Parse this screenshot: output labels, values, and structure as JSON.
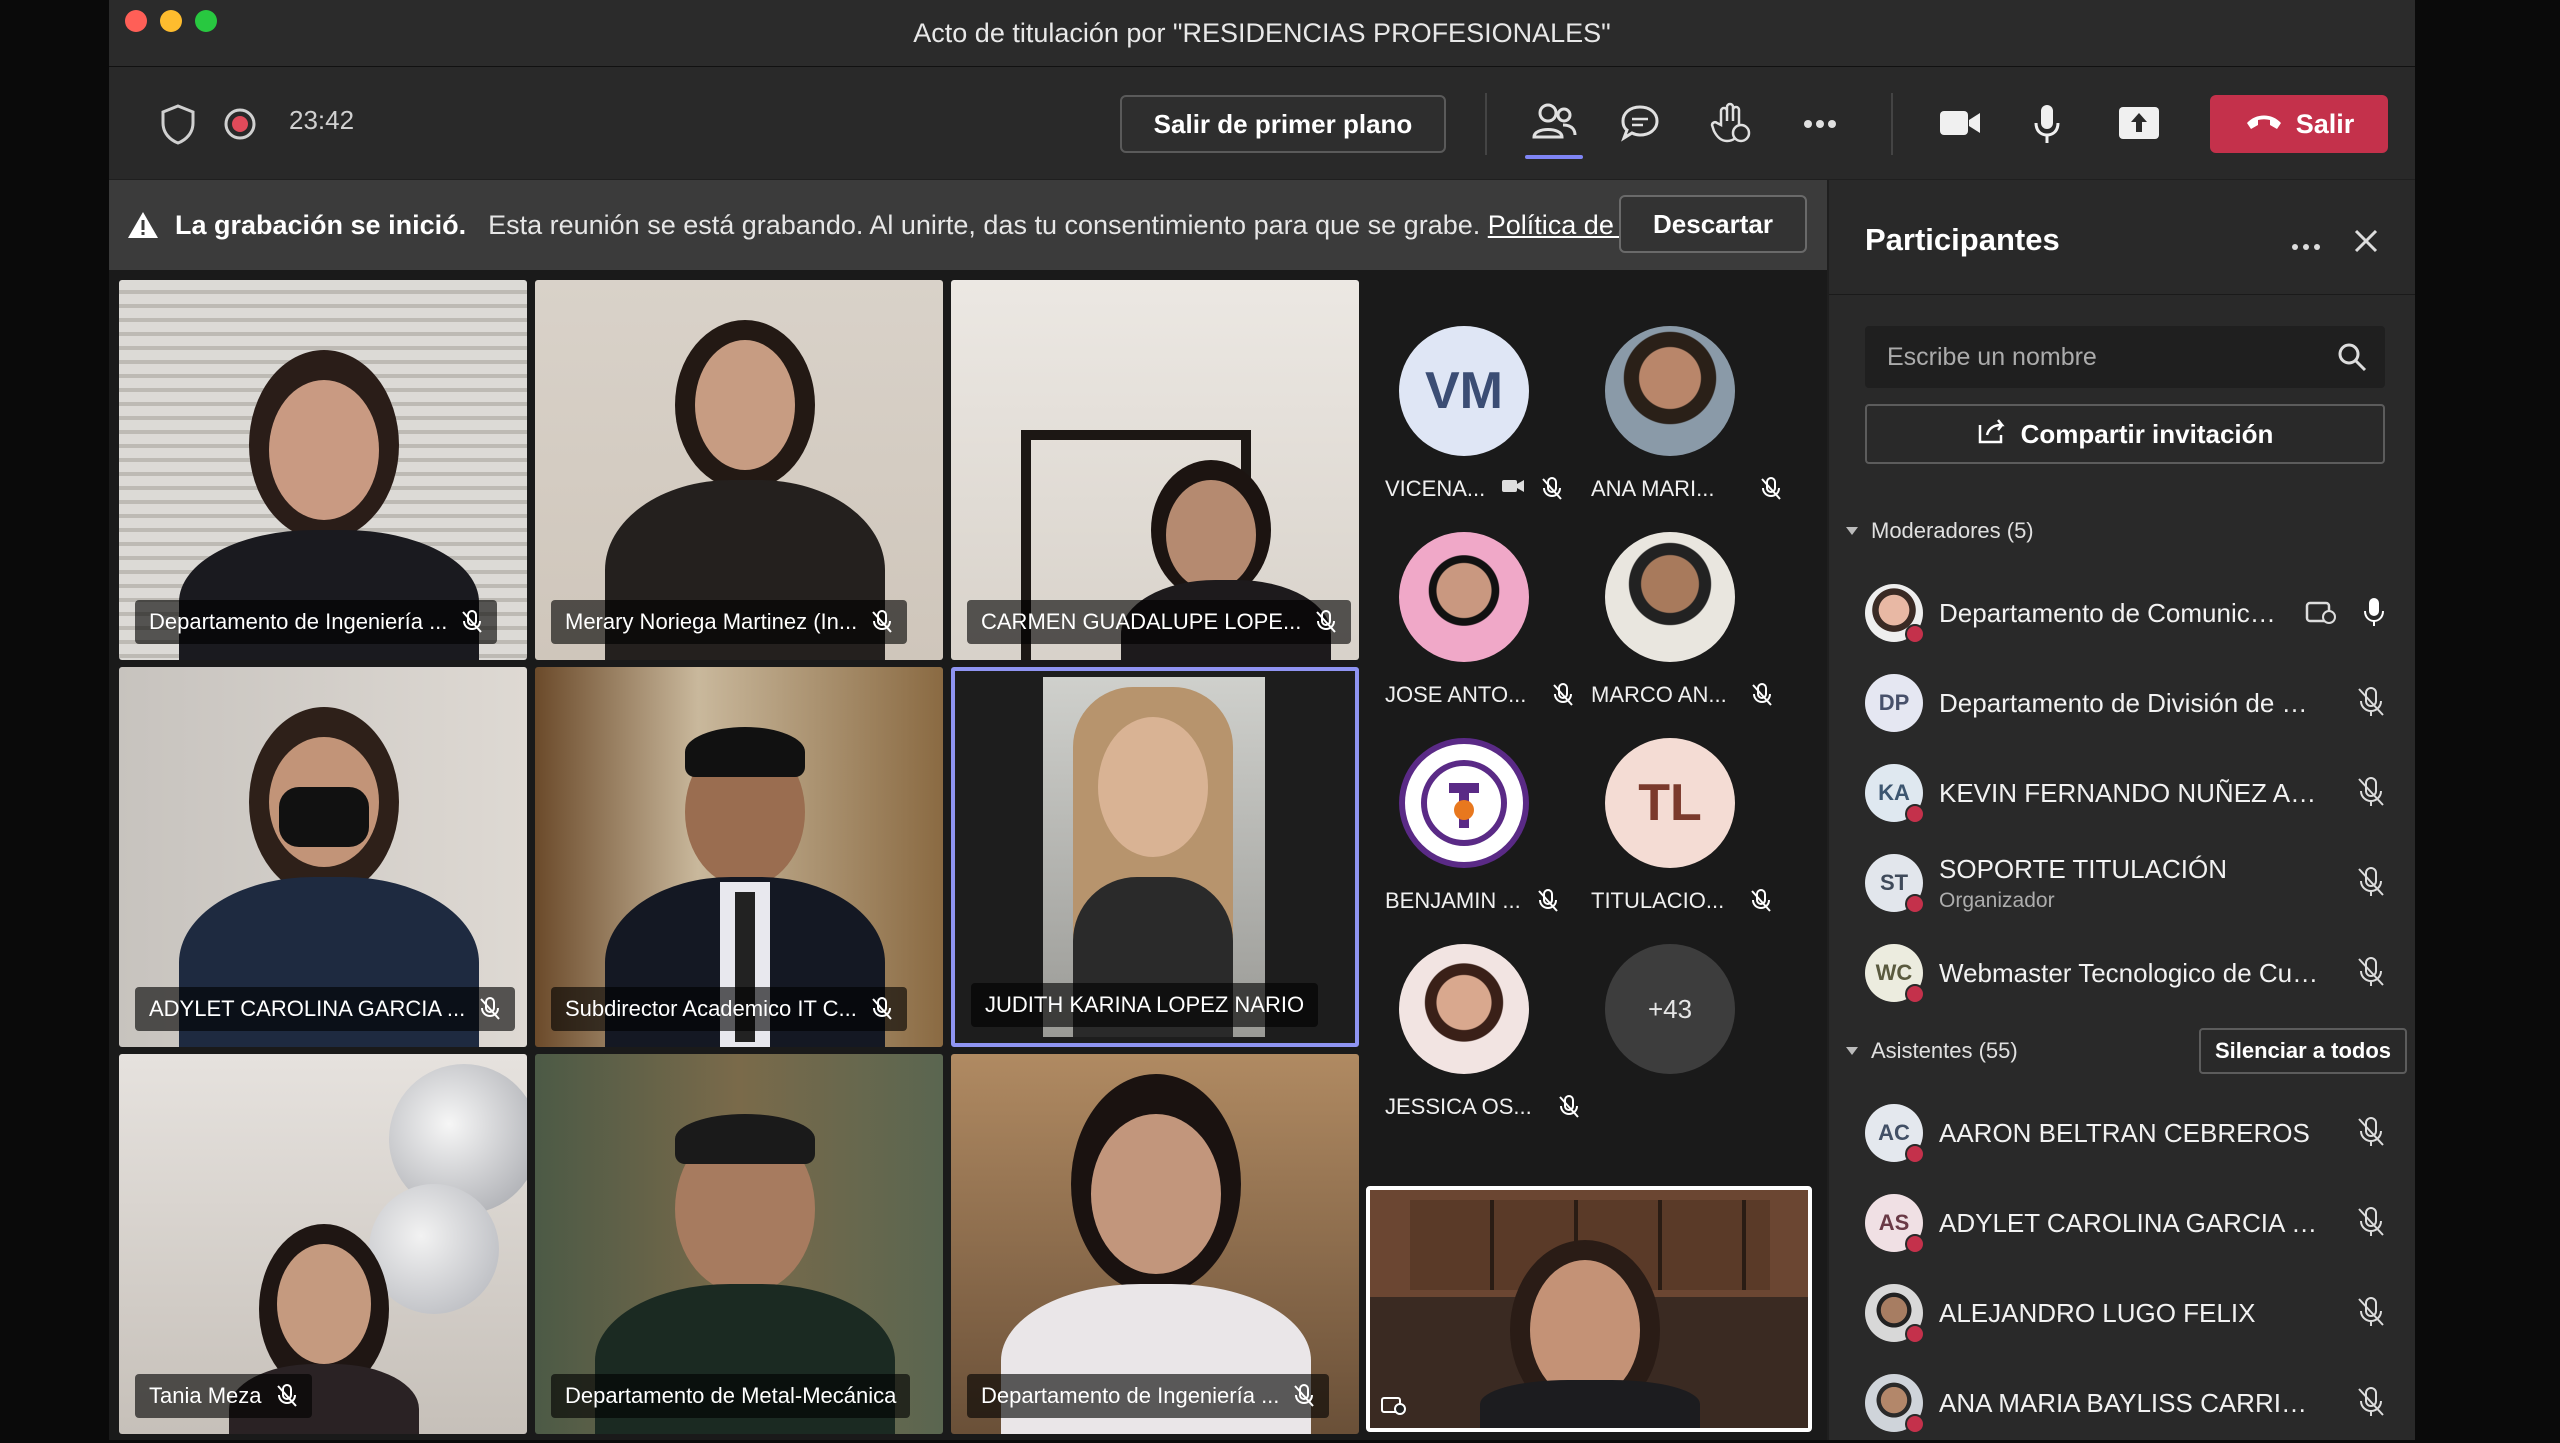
{
  "window": {
    "title": "Acto de titulación por \"RESIDENCIAS PROFESIONALES\""
  },
  "toolbar": {
    "timer": "23:42",
    "exit_spotlight_label": "Salir de primer plano",
    "leave_label": "Salir",
    "icons": [
      "shield-icon",
      "record-icon",
      "people-icon",
      "chat-icon",
      "raise-hand-icon",
      "more-icon",
      "camera-icon",
      "mic-icon",
      "share-icon",
      "hangup-icon"
    ]
  },
  "banner": {
    "title": "La grabación se inició.",
    "text": "Esta reunión se está grabando. Al unirte, das tu consentimiento para que se grabe.",
    "link": "Política de ...",
    "dismiss_label": "Descartar"
  },
  "video_tiles": [
    {
      "name": "Departamento de Ingeniería ...",
      "muted": true
    },
    {
      "name": "Merary Noriega Martinez (In...",
      "muted": true
    },
    {
      "name": "CARMEN GUADALUPE LOPE...",
      "muted": true
    },
    {
      "name": "ADYLET CAROLINA GARCIA ...",
      "muted": true
    },
    {
      "name": "Subdirector Academico IT C...",
      "muted": true
    },
    {
      "name": "JUDITH KARINA LOPEZ NARIO",
      "muted": false,
      "speaking": true
    },
    {
      "name": "Tania Meza",
      "muted": true
    },
    {
      "name": "Departamento de Metal-Mecánica",
      "muted": false
    },
    {
      "name": "Departamento de Ingeniería ...",
      "muted": true
    }
  ],
  "side_participants": [
    {
      "initials": "VM",
      "name": "VICENA...",
      "avatar_color": "#dfe6f5",
      "text_color": "#3b4d74"
    },
    {
      "initials": "",
      "name": "ANA MARI..."
    },
    {
      "initials": "",
      "name": "JOSE ANTO..."
    },
    {
      "initials": "",
      "name": "MARCO AN..."
    },
    {
      "initials": "",
      "name": "BENJAMIN ..."
    },
    {
      "initials": "TL",
      "name": "TITULACIO...",
      "avatar_color": "#f4dcd4",
      "text_color": "#7b3a2c"
    },
    {
      "initials": "",
      "name": "JESSICA OS..."
    },
    {
      "initials": "+43",
      "name": ""
    }
  ],
  "panel": {
    "title": "Participantes",
    "search_placeholder": "Escribe un nombre",
    "share_label": "Compartir invitación",
    "moderators_label": "Moderadores (5)",
    "attendees_label": "Asistentes (55)",
    "mute_all_label": "Silenciar a todos",
    "moderators": [
      {
        "initials": "",
        "name": "Departamento de Comunica...",
        "sub": ""
      },
      {
        "initials": "DP",
        "name": "Departamento de División de Es...",
        "sub": ""
      },
      {
        "initials": "KA",
        "name": "KEVIN FERNANDO NUÑEZ AGUI...",
        "sub": ""
      },
      {
        "initials": "ST",
        "name": "SOPORTE TITULACIÓN",
        "sub": "Organizador"
      },
      {
        "initials": "WC",
        "name": "Webmaster Tecnologico de Culi...",
        "sub": ""
      }
    ],
    "attendees": [
      {
        "initials": "AC",
        "name": "AARON BELTRAN CEBREROS"
      },
      {
        "initials": "AS",
        "name": "ADYLET CAROLINA GARCIA SAL..."
      },
      {
        "initials": "",
        "name": "ALEJANDRO LUGO FELIX"
      },
      {
        "initials": "",
        "name": "ANA MARIA BAYLISS CARRILLO"
      }
    ]
  },
  "colors": {
    "accent": "#7f85f5",
    "danger": "#c4314b",
    "panel_bg": "#292929"
  }
}
